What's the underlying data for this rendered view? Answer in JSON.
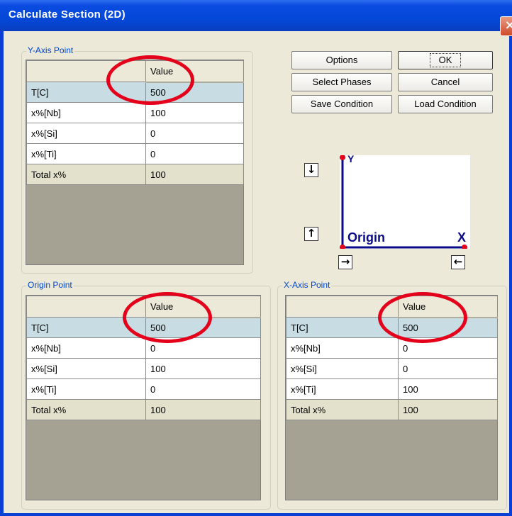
{
  "window": {
    "title": "Calculate Section (2D)",
    "close_symbol": "×"
  },
  "y_axis_point": {
    "label": "Y-Axis Point",
    "header": "Value",
    "rows": [
      {
        "name": "T[C]",
        "value": "500"
      },
      {
        "name": "x%[Nb]",
        "value": "100"
      },
      {
        "name": "x%[Si]",
        "value": "0"
      },
      {
        "name": "x%[Ti]",
        "value": "0"
      },
      {
        "name": "Total x%",
        "value": "100"
      }
    ]
  },
  "origin_point": {
    "label": "Origin Point",
    "header": "Value",
    "rows": [
      {
        "name": "T[C]",
        "value": "500"
      },
      {
        "name": "x%[Nb]",
        "value": "0"
      },
      {
        "name": "x%[Si]",
        "value": "100"
      },
      {
        "name": "x%[Ti]",
        "value": "0"
      },
      {
        "name": "Total x%",
        "value": "100"
      }
    ]
  },
  "x_axis_point": {
    "label": "X-Axis Point",
    "header": "Value",
    "rows": [
      {
        "name": "T[C]",
        "value": "500"
      },
      {
        "name": "x%[Nb]",
        "value": "0"
      },
      {
        "name": "x%[Si]",
        "value": "0"
      },
      {
        "name": "x%[Ti]",
        "value": "100"
      },
      {
        "name": "Total x%",
        "value": "100"
      }
    ]
  },
  "buttons": {
    "options": "Options",
    "ok": "OK",
    "select_phases": "Select Phases",
    "cancel": "Cancel",
    "save_condition": "Save Condition",
    "load_condition": "Load Condition"
  },
  "diagram": {
    "y_label": "Y",
    "origin_label": "Origin",
    "x_label": "X"
  },
  "arrow_buttons": {
    "down": "↓",
    "up": "↑",
    "right": "→",
    "left": "←"
  },
  "colors": {
    "title_bar": "#0a4ad6",
    "selected_row": "#c7dde3",
    "annotation": "#e4001b",
    "axis": "#0b0b8a"
  }
}
